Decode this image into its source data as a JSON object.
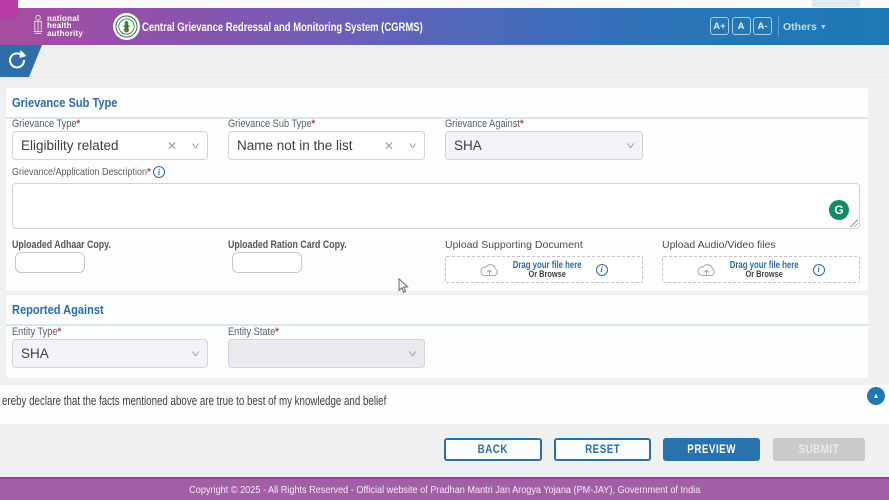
{
  "header": {
    "logo_lines": "national\nhealth\nauthority",
    "title": "Central Grievance Redressal and Monitoring System (CGRMS)",
    "font_increase": "A+",
    "font_normal": "A",
    "font_decrease": "A-",
    "others_label": "Others",
    "others_caret": "▼"
  },
  "grievance_section": {
    "heading": "Grievance Sub Type",
    "fields": [
      {
        "label": "Grievance Type",
        "req": "*",
        "value": "Eligibility related",
        "clear": "✕",
        "chev": "˅"
      },
      {
        "label": "Grievance Sub Type",
        "req": "*",
        "value": "Name not in the list",
        "clear": "✕",
        "chev": "˅"
      },
      {
        "label": "Grievance Against",
        "req": "*",
        "value": "SHA",
        "chev": "˅"
      }
    ],
    "description_label": "Grievance/Application Description",
    "description_req": "*",
    "info_glyph": "i",
    "grammarly_glyph": "G",
    "uploads": [
      {
        "label": "Uploaded Adhaar Copy."
      },
      {
        "label": "Uploaded Ration Card Copy."
      },
      {
        "label": "Upload Supporting Document",
        "drag": "Drag your file here",
        "browse": "Or Browse"
      },
      {
        "label": "Upload Audio/Video files",
        "drag": "Drag your file here",
        "browse": "Or Browse"
      }
    ]
  },
  "reported_section": {
    "heading": "Reported Against",
    "fields": [
      {
        "label": "Entity Type",
        "req": "*",
        "value": "SHA",
        "chev": "˅"
      },
      {
        "label": "Entity State",
        "req": "*",
        "value": "",
        "chev": "˅"
      }
    ]
  },
  "declaration": "ereby declare that the facts mentioned above are true to best of my knowledge and belief",
  "scroll_top_glyph": "▲",
  "buttons": {
    "back": "BACK",
    "reset": "RESET",
    "preview": "PREVIEW",
    "submit": "SUBMIT"
  },
  "footer": "Copyright © 2025 - All Rights Reserved - Official website of Pradhan Mantri Jan Arogya Yojana (PM-JAY), Government of India"
}
